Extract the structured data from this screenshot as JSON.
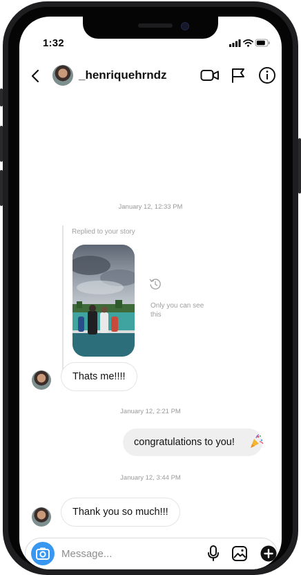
{
  "status_bar": {
    "time": "1:32"
  },
  "header": {
    "username": "_henriquehrndz"
  },
  "chat": {
    "timestamps": [
      "January 12, 12:33 PM",
      "January 12, 2:21 PM",
      "January 12, 3:44 PM"
    ],
    "story_reply": {
      "label": "Replied to your story",
      "notice": "Only you can see this"
    },
    "messages": [
      {
        "from": "them",
        "text": "Thats me!!!!"
      },
      {
        "from": "me",
        "text": "congratulations to you!"
      },
      {
        "from": "them",
        "text": "Thank you so much!!!"
      }
    ]
  },
  "composer": {
    "placeholder": "Message..."
  },
  "colors": {
    "accent": "#3897f0",
    "outgoing_bubble": "#efefef",
    "timestamp": "#9a9a9a"
  },
  "icons": [
    "back-chevron-icon",
    "video-call-icon",
    "flag-icon",
    "info-icon",
    "history-icon",
    "party-popper-icon",
    "camera-icon",
    "microphone-icon",
    "gallery-icon",
    "plus-icon"
  ]
}
